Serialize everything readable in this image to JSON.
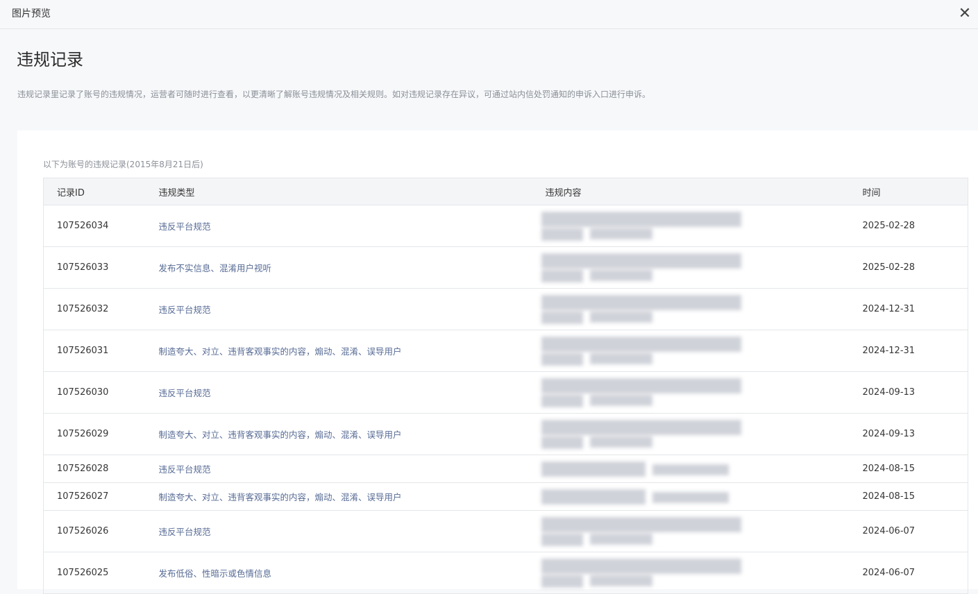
{
  "window": {
    "title": "图片预览",
    "close_icon": "close-icon"
  },
  "page": {
    "title": "违规记录",
    "description": "违规记录里记录了账号的违规情况，运营者可随时进行查看，以更清晰了解账号违规情况及相关规则。如对违规记录存在异议，可通过站内信处罚通知的申诉入口进行申诉。"
  },
  "records": {
    "note": "以下为账号的违规记录(2015年8月21日后)",
    "columns": [
      "记录ID",
      "违规类型",
      "违规内容",
      "时间"
    ],
    "rows": [
      {
        "id": "107526034",
        "type": "违反平台规范",
        "time": "2025-02-28"
      },
      {
        "id": "107526033",
        "type": "发布不实信息、混淆用户视听",
        "time": "2025-02-28"
      },
      {
        "id": "107526032",
        "type": "违反平台规范",
        "time": "2024-12-31"
      },
      {
        "id": "107526031",
        "type": "制造夸大、对立、违背客观事实的内容，煽动、混淆、误导用户",
        "time": "2024-12-31"
      },
      {
        "id": "107526030",
        "type": "违反平台规范",
        "time": "2024-09-13"
      },
      {
        "id": "107526029",
        "type": "制造夸大、对立、违背客观事实的内容，煽动、混淆、误导用户",
        "time": "2024-09-13"
      },
      {
        "id": "107526028",
        "type": "违反平台规范",
        "time": "2024-08-15"
      },
      {
        "id": "107526027",
        "type": "制造夸大、对立、违背客观事实的内容，煽动、混淆、误导用户",
        "time": "2024-08-15"
      },
      {
        "id": "107526026",
        "type": "违反平台规范",
        "time": "2024-06-07"
      },
      {
        "id": "107526025",
        "type": "发布低俗、性暗示或色情信息",
        "time": "2024-06-07"
      }
    ]
  }
}
